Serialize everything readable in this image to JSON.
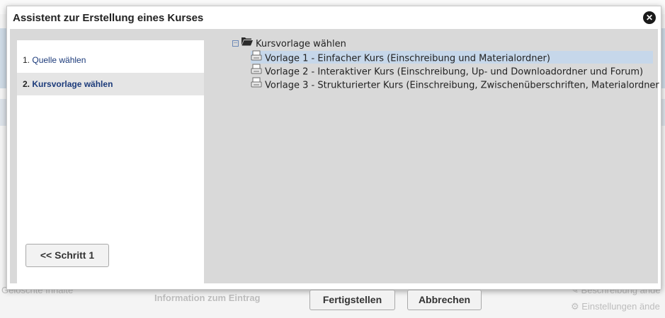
{
  "dialog": {
    "title": "Assistent zur Erstellung eines Kurses",
    "close_icon": "close-icon"
  },
  "steps": [
    {
      "number": "1.",
      "label": "Quelle wählen",
      "active": false
    },
    {
      "number": "2.",
      "label": "Kursvorlage wählen",
      "active": true
    }
  ],
  "back_button": "<< Schritt 1",
  "tree": {
    "root_label": "Kursvorlage wählen",
    "root_icon": "folder-open-icon",
    "items": [
      {
        "label": "Vorlage 1 - Einfacher Kurs (Einschreibung und Materialordner)",
        "selected": true,
        "icon": "template-icon"
      },
      {
        "label": "Vorlage 2 - Interaktiver Kurs (Einschreibung, Up- und Downloadordner und Forum)",
        "selected": false,
        "icon": "template-icon"
      },
      {
        "label": "Vorlage 3 - Strukturierter Kurs (Einschreibung, Zwischenüberschriften, Materialordner",
        "selected": false,
        "icon": "template-icon"
      }
    ]
  },
  "footer": {
    "finish_button": "Fertigstellen",
    "cancel_button": "Abbrechen"
  },
  "background": {
    "gelöschte": "Gelöschte Inhalte",
    "info": "Information zum Eintrag",
    "beschreibung": "Beschreibung ände",
    "einstellungen": "Einstellungen ände"
  },
  "colors": {
    "step_link": "#1b3a7a",
    "selected_row": "#c6d7ea",
    "panel_grey": "#d9d9d9"
  }
}
